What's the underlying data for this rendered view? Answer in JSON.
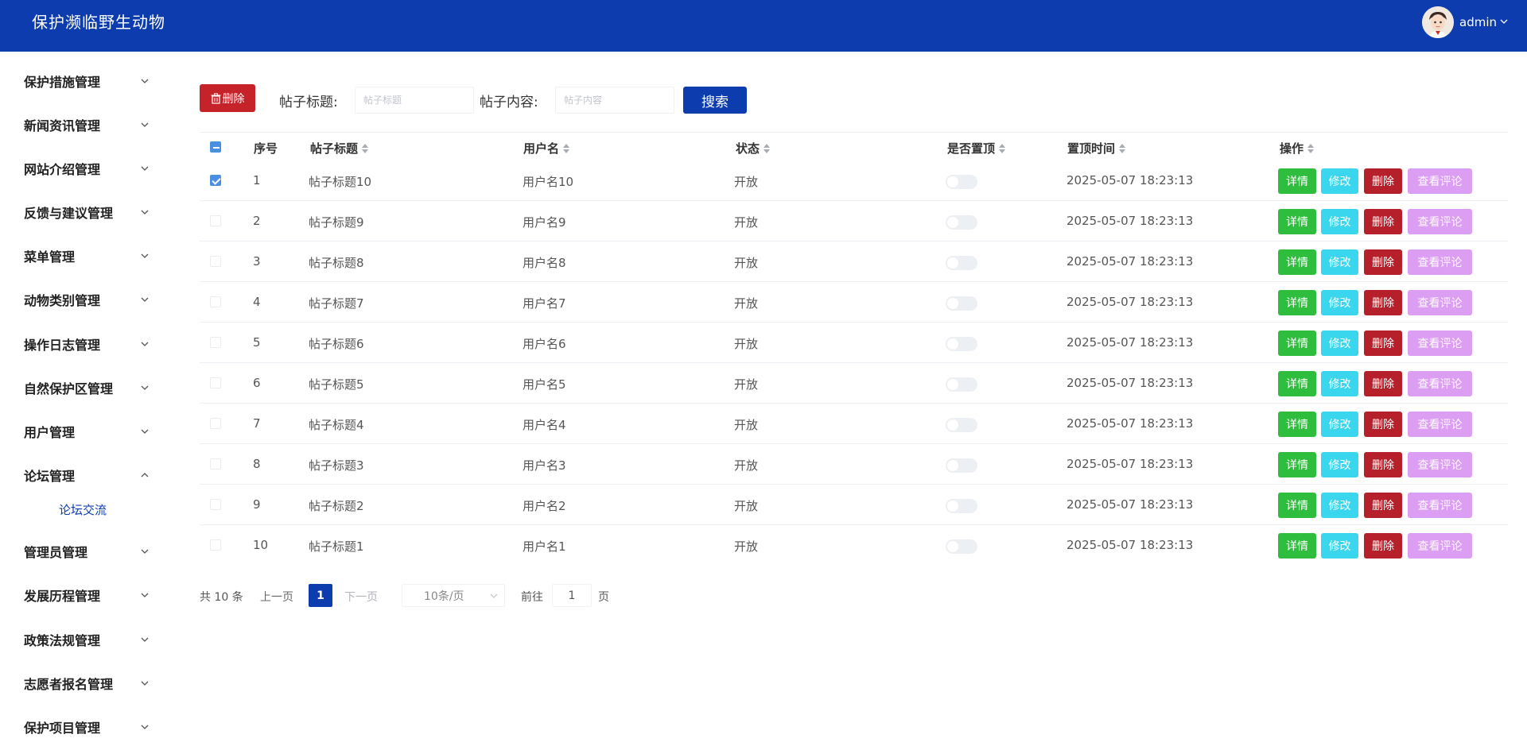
{
  "header": {
    "title": "保护濒临野生动物",
    "username": "admin"
  },
  "sidebar": {
    "items": [
      {
        "label": "保护措施管理",
        "expanded": false
      },
      {
        "label": "新闻资讯管理",
        "expanded": false
      },
      {
        "label": "网站介绍管理",
        "expanded": false
      },
      {
        "label": "反馈与建议管理",
        "expanded": false
      },
      {
        "label": "菜单管理",
        "expanded": false
      },
      {
        "label": "动物类别管理",
        "expanded": false
      },
      {
        "label": "操作日志管理",
        "expanded": false
      },
      {
        "label": "自然保护区管理",
        "expanded": false
      },
      {
        "label": "用户管理",
        "expanded": false
      },
      {
        "label": "论坛管理",
        "expanded": true
      },
      {
        "label": "管理员管理",
        "expanded": false
      },
      {
        "label": "发展历程管理",
        "expanded": false
      },
      {
        "label": "政策法规管理",
        "expanded": false
      },
      {
        "label": "志愿者报名管理",
        "expanded": false
      },
      {
        "label": "保护项目管理",
        "expanded": false
      }
    ],
    "submenu": {
      "label": "论坛交流"
    }
  },
  "toolbar": {
    "delete_label": "删除",
    "title_label": "帖子标题:",
    "title_placeholder": "帖子标题",
    "content_label": "帖子内容:",
    "content_placeholder": "帖子内容",
    "search_label": "搜索"
  },
  "table": {
    "headers": {
      "index": "序号",
      "title": "帖子标题",
      "username": "用户名",
      "status": "状态",
      "pinned": "是否置顶",
      "pin_time": "置顶时间",
      "actions": "操作"
    },
    "action_labels": {
      "detail": "详情",
      "edit": "修改",
      "delete": "删除",
      "comments": "查看评论"
    },
    "rows": [
      {
        "index": "1",
        "title": "帖子标题10",
        "username": "用户名10",
        "status": "开放",
        "pinned": false,
        "pin_time": "2025-05-07 18:23:13",
        "selected": true
      },
      {
        "index": "2",
        "title": "帖子标题9",
        "username": "用户名9",
        "status": "开放",
        "pinned": false,
        "pin_time": "2025-05-07 18:23:13",
        "selected": false
      },
      {
        "index": "3",
        "title": "帖子标题8",
        "username": "用户名8",
        "status": "开放",
        "pinned": false,
        "pin_time": "2025-05-07 18:23:13",
        "selected": false
      },
      {
        "index": "4",
        "title": "帖子标题7",
        "username": "用户名7",
        "status": "开放",
        "pinned": false,
        "pin_time": "2025-05-07 18:23:13",
        "selected": false
      },
      {
        "index": "5",
        "title": "帖子标题6",
        "username": "用户名6",
        "status": "开放",
        "pinned": false,
        "pin_time": "2025-05-07 18:23:13",
        "selected": false
      },
      {
        "index": "6",
        "title": "帖子标题5",
        "username": "用户名5",
        "status": "开放",
        "pinned": false,
        "pin_time": "2025-05-07 18:23:13",
        "selected": false
      },
      {
        "index": "7",
        "title": "帖子标题4",
        "username": "用户名4",
        "status": "开放",
        "pinned": false,
        "pin_time": "2025-05-07 18:23:13",
        "selected": false
      },
      {
        "index": "8",
        "title": "帖子标题3",
        "username": "用户名3",
        "status": "开放",
        "pinned": false,
        "pin_time": "2025-05-07 18:23:13",
        "selected": false
      },
      {
        "index": "9",
        "title": "帖子标题2",
        "username": "用户名2",
        "status": "开放",
        "pinned": false,
        "pin_time": "2025-05-07 18:23:13",
        "selected": false
      },
      {
        "index": "10",
        "title": "帖子标题1",
        "username": "用户名1",
        "status": "开放",
        "pinned": false,
        "pin_time": "2025-05-07 18:23:13",
        "selected": false
      }
    ]
  },
  "pagination": {
    "total_text": "共 10 条",
    "prev_label": "上一页",
    "current_page": "1",
    "next_label": "下一页",
    "page_size_label": "10条/页",
    "goto_label": "前往",
    "goto_value": "1",
    "page_suffix": "页"
  },
  "colors": {
    "primary": "#0c3cad",
    "danger": "#c5222a",
    "success": "#2ebd3c",
    "info": "#3ad6ee",
    "comment": "#dc9ef2"
  },
  "icons": {
    "avatar": "avatar-icon",
    "trash": "trash-icon",
    "menu_arrow": "chevron-down-icon",
    "menu_arrow_open": "chevron-up-icon",
    "sort": "sort-icon"
  }
}
